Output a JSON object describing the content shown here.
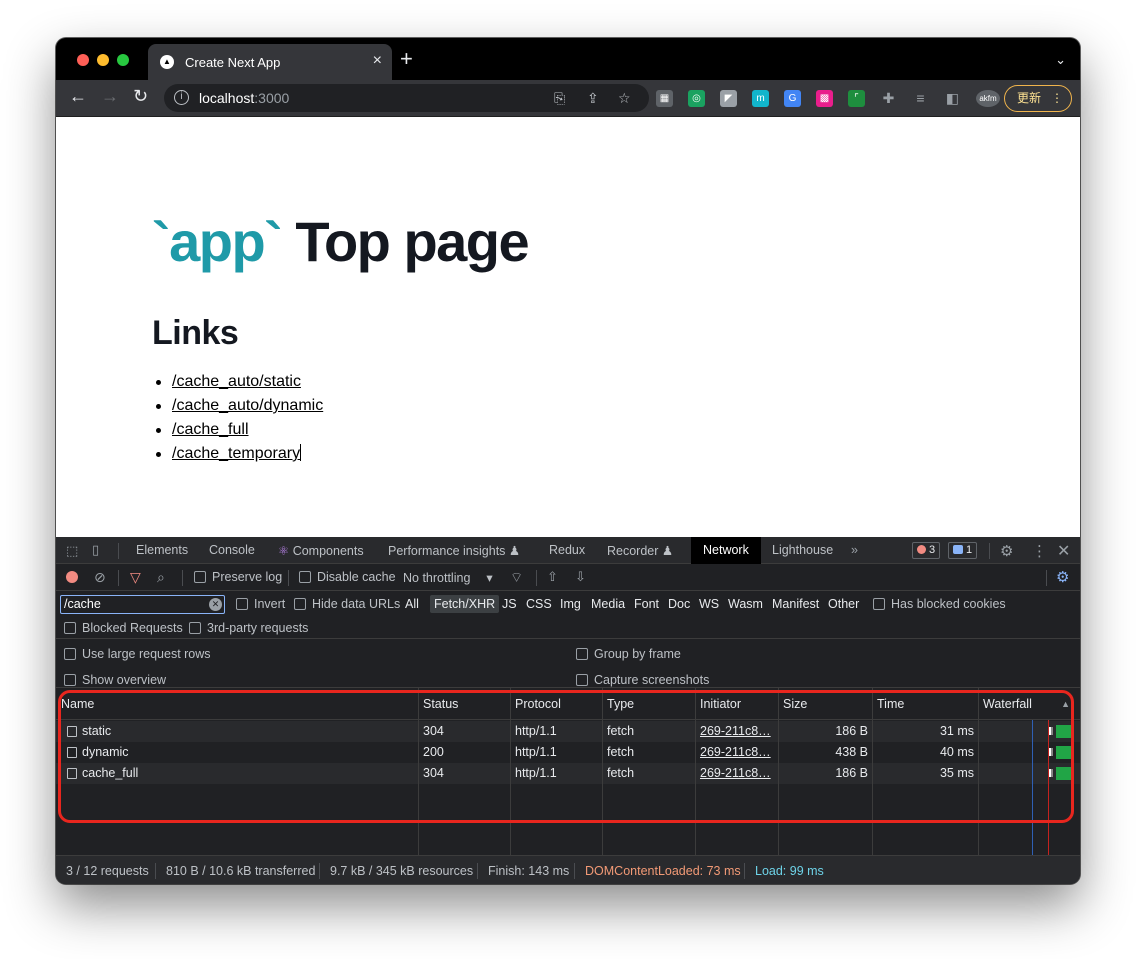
{
  "browser": {
    "tab_title": "Create Next App",
    "tab_close": "×",
    "new_tab": "+",
    "tab_menu": "⌄",
    "url_host": "localhost",
    "url_port": ":3000",
    "update_label": "更新",
    "update_menu": "⋮",
    "extensions": [
      {
        "name": "qr-icon",
        "color": "#5f6368",
        "glyph": "▦"
      },
      {
        "name": "target-icon",
        "color": "#1aa260",
        "glyph": "◎"
      },
      {
        "name": "ext-arrow-icon",
        "color": "#9aa0a6",
        "glyph": "◤"
      },
      {
        "name": "ext-m-icon",
        "color": "#12b5cb",
        "glyph": "m"
      },
      {
        "name": "ext-g-icon",
        "color": "#4285f4",
        "glyph": "G"
      },
      {
        "name": "ext-pink-icon",
        "color": "#e91e8c",
        "glyph": "▩"
      },
      {
        "name": "screenshot-icon",
        "color": "#1e8e3e",
        "glyph": "⌜"
      },
      {
        "name": "puzzle-icon",
        "color": "#9aa0a6",
        "glyph": "✚"
      },
      {
        "name": "reading-list-icon",
        "color": "#9aa0a6",
        "glyph": "≡"
      },
      {
        "name": "sidepanel-icon",
        "color": "#9aa0a6",
        "glyph": "◧"
      }
    ],
    "profile_label": "akfm"
  },
  "page": {
    "hero_code": "`app`",
    "hero_text": "Top page",
    "links_heading": "Links",
    "links": [
      "/cache_auto/static",
      "/cache_auto/dynamic",
      "/cache_full",
      "/cache_temporary"
    ]
  },
  "devtools": {
    "tabs": [
      "Elements",
      "Console",
      "Components",
      "Performance insights",
      "Redux",
      "Recorder",
      "Network",
      "Lighthouse"
    ],
    "components_badge": "⚛",
    "flask": "♟",
    "more": "»",
    "error_count": "3",
    "message_count": "1",
    "toolbar": {
      "preserve_log": "Preserve log",
      "disable_cache": "Disable cache",
      "throttling": "No throttling",
      "throttle_arrow": "▾"
    },
    "filter": {
      "value": "/cache",
      "invert": "Invert",
      "hide_data_urls": "Hide data URLs",
      "types": [
        "All",
        "Fetch/XHR",
        "JS",
        "CSS",
        "Img",
        "Media",
        "Font",
        "Doc",
        "WS",
        "Wasm",
        "Manifest",
        "Other"
      ],
      "active_type": "Fetch/XHR",
      "has_blocked_cookies": "Has blocked cookies",
      "blocked_requests": "Blocked Requests",
      "third_party": "3rd-party requests"
    },
    "settings": {
      "large_rows": "Use large request rows",
      "show_overview": "Show overview",
      "group_by_frame": "Group by frame",
      "capture_screenshots": "Capture screenshots"
    },
    "table": {
      "headers": [
        "Name",
        "Status",
        "Protocol",
        "Type",
        "Initiator",
        "Size",
        "Time",
        "Waterfall"
      ],
      "sort_indicator": "▲",
      "rows": [
        {
          "name": "static",
          "status": "304",
          "protocol": "http/1.1",
          "type": "fetch",
          "initiator": "269-211c8…",
          "size": "186 B",
          "time": "31 ms"
        },
        {
          "name": "dynamic",
          "status": "200",
          "protocol": "http/1.1",
          "type": "fetch",
          "initiator": "269-211c8…",
          "size": "438 B",
          "time": "40 ms"
        },
        {
          "name": "cache_full",
          "status": "304",
          "protocol": "http/1.1",
          "type": "fetch",
          "initiator": "269-211c8…",
          "size": "186 B",
          "time": "35 ms"
        }
      ]
    },
    "status": {
      "requests": "3 / 12 requests",
      "transferred": "810 B / 10.6 kB transferred",
      "resources": "9.7 kB / 345 kB resources",
      "finish": "Finish: 143 ms",
      "dom_content_loaded": "DOMContentLoaded: 73 ms",
      "load": "Load: 99 ms"
    }
  }
}
